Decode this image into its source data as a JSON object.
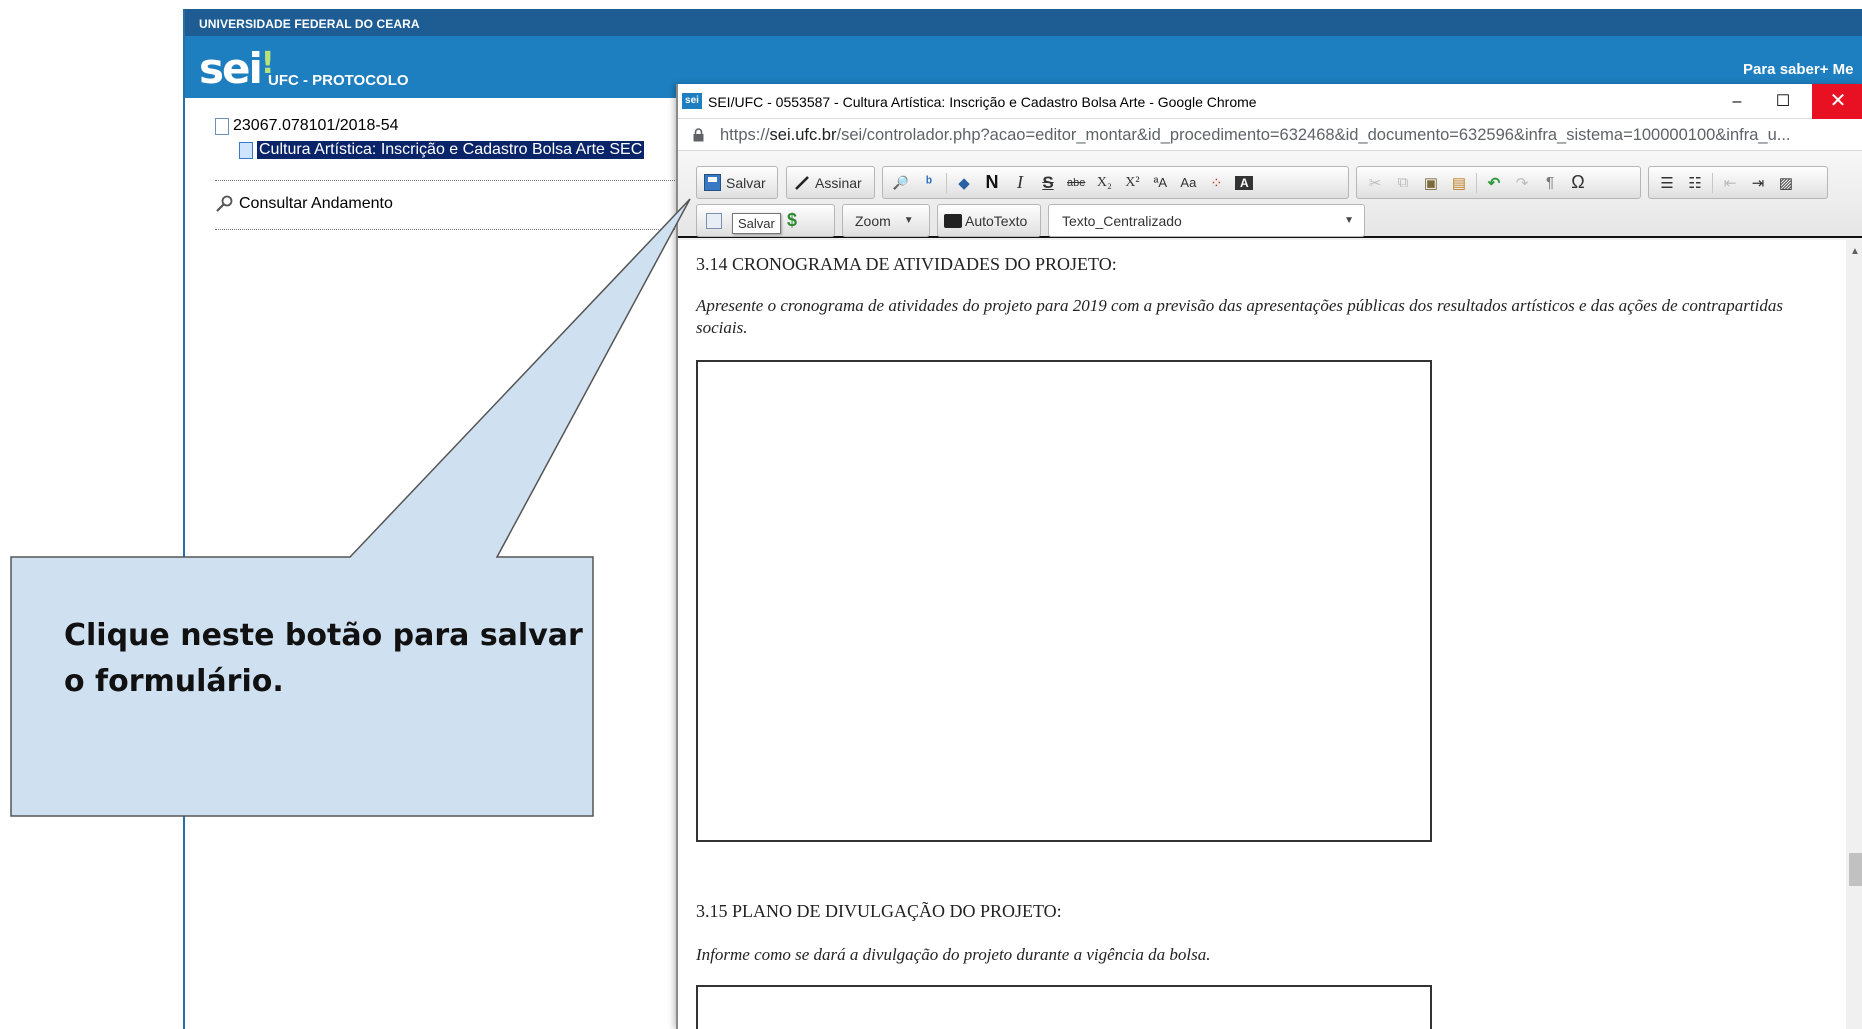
{
  "sei": {
    "org": "UNIVERSIDADE FEDERAL DO CEARA",
    "logo": "sei",
    "unit": "UFC - PROTOCOLO",
    "para_saber": "Para saber+  Me",
    "tree": {
      "process_number": "23067.078101/2018-54",
      "document_label": "Cultura Artística: Inscrição e Cadastro Bolsa Arte SEC",
      "consult_label": "Consultar Andamento"
    }
  },
  "chrome": {
    "favicon": "sei",
    "title": "SEI/UFC - 0553587 - Cultura Artística: Inscrição e Cadastro Bolsa Arte - Google Chrome",
    "url_prefix": "https://",
    "url_host": "sei.ufc.br",
    "url_path": "/sei/controlador.php?acao=editor_montar&id_procedimento=632468&id_documento=632596&infra_sistema=100000100&infra_u...",
    "controls": {
      "minimize": "–",
      "maximize": "☐",
      "close": "✕"
    }
  },
  "toolbar": {
    "save_label": "Salvar",
    "sign_label": "Assinar",
    "tooltip": "Salvar",
    "zoom_label": "Zoom",
    "autotext_label": "AutoTexto",
    "style_value": "Texto_Centralizado",
    "icons": {
      "find": "🔎",
      "replace": "ᵇ",
      "eraser": "◆",
      "bold": "N",
      "italic": "I",
      "strike_s": "S",
      "strike_abe": "abe",
      "subscript": "X₂",
      "superscript": "X²",
      "upper": "ªA",
      "lower": "Aa",
      "table": "⁘",
      "textcolor": "A",
      "cut": "✂",
      "copy": "⧉",
      "paste": "▣",
      "pasteword": "▤",
      "undo": "↶",
      "redo": "↷",
      "pilcrow": "¶",
      "omega": "Ω",
      "numlist": "☰",
      "bullist": "☷",
      "outdent": "⇤",
      "indent": "⇥",
      "image": "▨",
      "dollar": "$"
    }
  },
  "editor": {
    "heading_314": "3.14 CRONOGRAMA DE ATIVIDADES DO PROJETO:",
    "italic_314": "Apresente o cronograma de atividades do projeto para 2019 com a previsão das apresentações públicas dos resultados artísticos e das ações de contrapartidas sociais.",
    "heading_315": "3.15 PLANO DE DIVULGAÇÃO DO PROJETO:",
    "italic_315": "Informe como se dará a divulgação do projeto durante a vigência da bolsa."
  },
  "callout": {
    "text": "Clique neste botão para salvar o formulário.",
    "fill": "#cfe0f1",
    "stroke": "#555555"
  }
}
